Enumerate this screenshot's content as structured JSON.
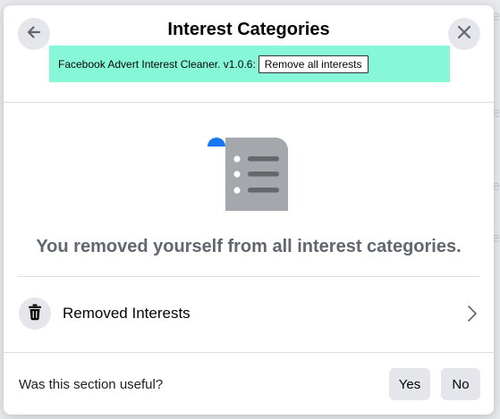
{
  "dialog": {
    "title": "Interest Categories"
  },
  "extension": {
    "label": "Facebook Advert Interest Cleaner. v1.0.6:",
    "button_label": "Remove all interests"
  },
  "main": {
    "message": "You removed yourself from all interest categories."
  },
  "removed_row": {
    "label": "Removed Interests"
  },
  "feedback": {
    "question": "Was this section useful?",
    "yes_label": "Yes",
    "no_label": "No"
  },
  "icons": {
    "back": "arrow-left-icon",
    "close": "close-icon",
    "list": "list-document-icon",
    "trash": "trash-icon",
    "chevron": "chevron-right-icon"
  },
  "colors": {
    "extension_bar": "#87f8d7",
    "accent_blue": "#1877f2",
    "button_gray": "#e4e6eb",
    "muted_text": "#606770"
  }
}
